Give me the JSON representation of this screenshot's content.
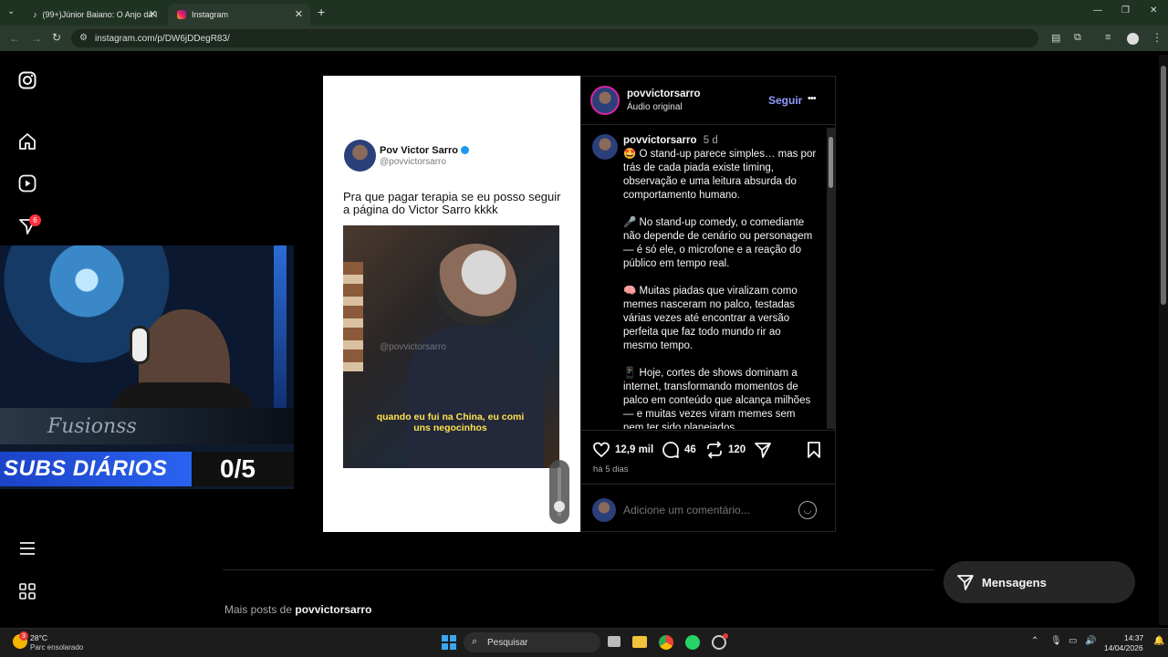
{
  "browser": {
    "tabs": [
      {
        "label": "(99+)Júnior Baiano: O Anjo da I",
        "icon": "tiktok-icon"
      },
      {
        "label": "Instagram",
        "icon": "instagram-icon"
      }
    ],
    "new_tab": "+",
    "url": "instagram.com/p/DW6jDDegR83/",
    "window_controls": [
      "—",
      "❐",
      "✕"
    ]
  },
  "nav": {
    "items": [
      "instagram-logo",
      "home",
      "reels",
      "messages",
      "menu",
      "more-apps"
    ],
    "notification_count": "6"
  },
  "webcam": {
    "tag": "Fusionss",
    "banner_label": "SUBS DIÁRIOS",
    "banner_count": "0/5"
  },
  "media": {
    "tweet_name": "Pov Victor Sarro",
    "tweet_handle": "@povvictorsarro",
    "tweet_text": "Pra que pagar terapia se eu posso seguir a página do Victor Sarro kkkk",
    "video_watermark": "@povvictorsarro",
    "video_subtitle": "quando eu fui na China, eu comi uns negocinhos",
    "volume_level": 0.5
  },
  "post": {
    "username": "povvictorsarro",
    "audio": "Áudio original",
    "follow": "Seguir",
    "more": "•••",
    "caption_user": "povvictorsarro",
    "caption_time": "5 d",
    "caption_paragraphs": [
      "🤩 O stand-up parece simples… mas por trás de cada piada existe timing, observação e uma leitura absurda do comportamento humano.",
      "🎤 No stand-up comedy, o comediante não depende de cenário ou personagem — é só ele, o microfone e a reação do público em tempo real.",
      "🧠 Muitas piadas que viralizam como memes nasceram no palco, testadas várias vezes até encontrar a versão perfeita que faz todo mundo rir ao mesmo tempo.",
      "📱 Hoje, cortes de shows dominam a internet, transformando momentos de palco em conteúdo que alcança milhões — e muitas vezes viram memes sem nem ter sido planejados."
    ],
    "likes": "12,9 mil",
    "comments": "46",
    "reposts": "120",
    "posted": "há 5 dias",
    "comment_placeholder": "Adicione um comentário..."
  },
  "more_posts": {
    "prefix": "Mais posts de ",
    "user": "povvictorsarro"
  },
  "messages_button": "Mensagens",
  "taskbar": {
    "temp": "28°C",
    "weather": "Parc ensolarado",
    "weather_badge": "3",
    "search": "Pesquisar",
    "time": "14:37",
    "date": "14/04/2026"
  },
  "colors": {
    "accent_blue": "#8e9cff",
    "badge_red": "#ff3040",
    "browser_green": "#2b3a2e"
  }
}
